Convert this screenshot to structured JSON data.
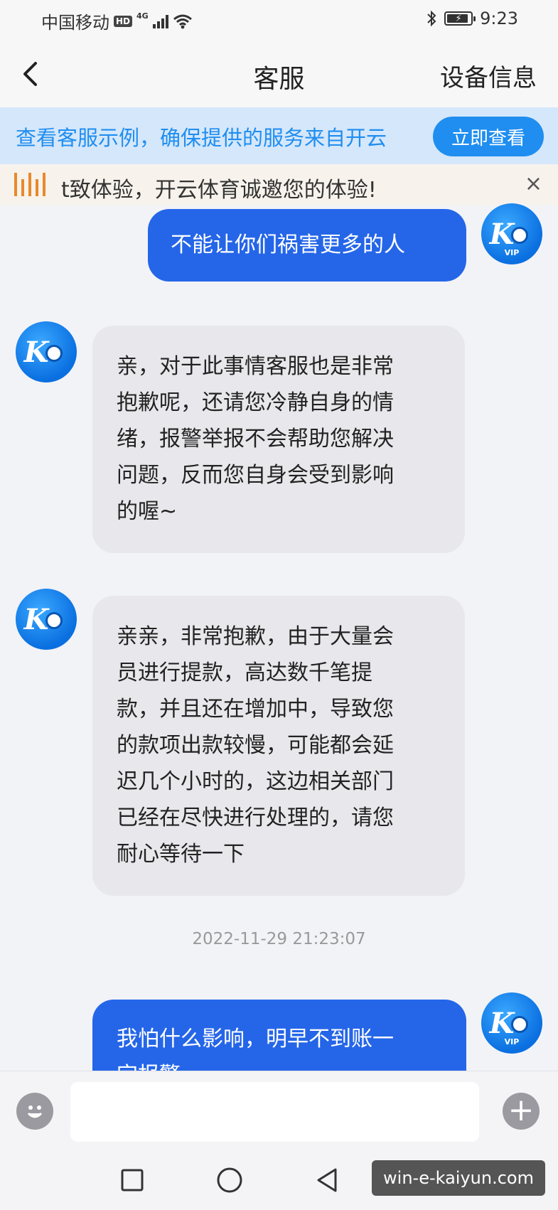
{
  "status_bar": {
    "carrier": "中国移动",
    "hd": "HD",
    "network": "4G",
    "time": "9:23"
  },
  "header": {
    "title": "客服",
    "right_action": "设备信息"
  },
  "banner": {
    "text": "查看客服示例，确保提供的服务来自开云",
    "button": "立即查看"
  },
  "notice": {
    "text": "t致体验，开云体育诚邀您的体验!",
    "close": "×"
  },
  "messages": {
    "m1": "不能让你们祸害更多的人",
    "m2": [
      "亲，对于此事情客服也是非常",
      "抱歉呢，还请您冷静自身的情",
      "绪，报警举报不会帮助您解决",
      "问题，反而您自身会受到影响",
      "的喔~"
    ],
    "m3": [
      "亲亲，非常抱歉，由于大量会",
      "员进行提款，高达数千笔提",
      "款，并且还在增加中，导致您",
      "的款项出款较慢，可能都会延",
      "迟几个小时的，这边相关部门",
      "已经在尽快进行处理的，请您",
      "耐心等待一下"
    ],
    "timestamp": "2022-11-29 21:23:07",
    "m4": [
      "我怕什么影响，明早不到账一",
      "定报警"
    ]
  },
  "avatar": {
    "vip": "VIP"
  },
  "input_bar": {
    "placeholder": "",
    "plus": "+"
  },
  "watermark": "win-e-kaiyun.com",
  "colors": {
    "accent": "#1f8ef0",
    "outgoing_bubble": "#2566e8",
    "incoming_bubble": "#e8e8ec",
    "notice_icon": "#e8892c"
  }
}
